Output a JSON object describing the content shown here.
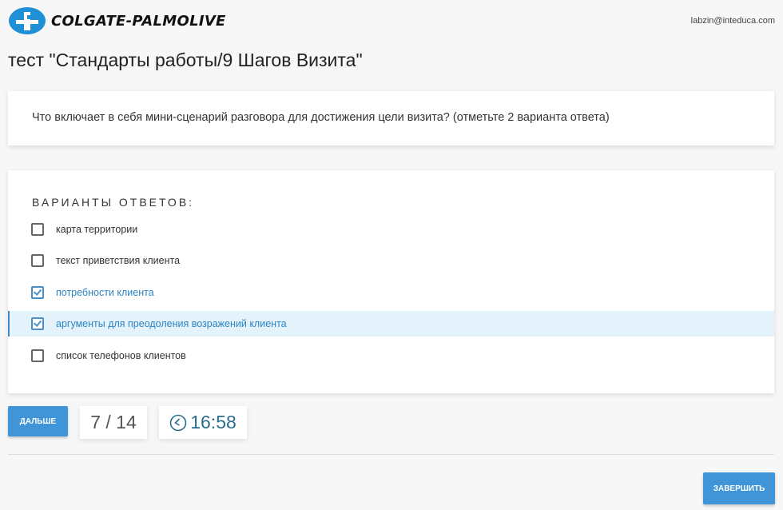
{
  "header": {
    "brand": "COLGATE-PALMOLIVE",
    "user_email": "labzin@inteduca.com",
    "brand_color": "#1f8fd6"
  },
  "test": {
    "title": "тест \"Стандарты работы/9 Шагов Визита\""
  },
  "question": {
    "text": "Что включает в себя мини-сценарий разговора для достижения цели визита? (отметьте 2 варианта ответа)"
  },
  "answers": {
    "heading": "ВАРИАНТЫ ОТВЕТОВ:",
    "items": [
      {
        "label": "карта территории",
        "checked": false
      },
      {
        "label": "текст приветствия клиента",
        "checked": false
      },
      {
        "label": "потребности клиента",
        "checked": true
      },
      {
        "label": "аргументы для преодоления возражений клиента",
        "checked": true
      },
      {
        "label": "список телефонов клиентов",
        "checked": false
      }
    ]
  },
  "controls": {
    "next_label": "ДАЛЬШЕ",
    "finish_label": "ЗАВЕРШИТЬ",
    "progress": "7 / 14",
    "timer": "16:58",
    "accent_color": "#3f95d8"
  }
}
